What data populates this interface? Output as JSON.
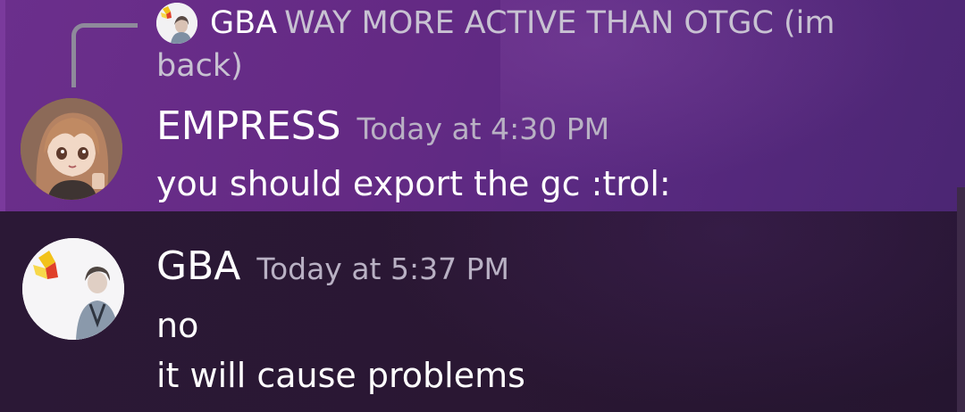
{
  "reply_preview": {
    "author": "GBA",
    "text": "WAY MORE ACTIVE THAN OTGC (im back)",
    "avatar_icon": "user-avatar-icon"
  },
  "messages": [
    {
      "author": "EMPRESS",
      "timestamp": "Today at 4:30 PM",
      "lines": [
        "you should export the gc :trol:"
      ],
      "avatar_icon": "anime-girl-avatar-icon"
    },
    {
      "author": "GBA",
      "timestamp": "Today at 5:37 PM",
      "lines": [
        "no",
        "it will cause problems"
      ],
      "avatar_icon": "user-avatar-icon"
    }
  ],
  "colors": {
    "highlight_background": "#642a84",
    "chat_background": "#2a1733",
    "timestamp": "#b9b1c4",
    "reply_text": "#c8c2d2"
  }
}
